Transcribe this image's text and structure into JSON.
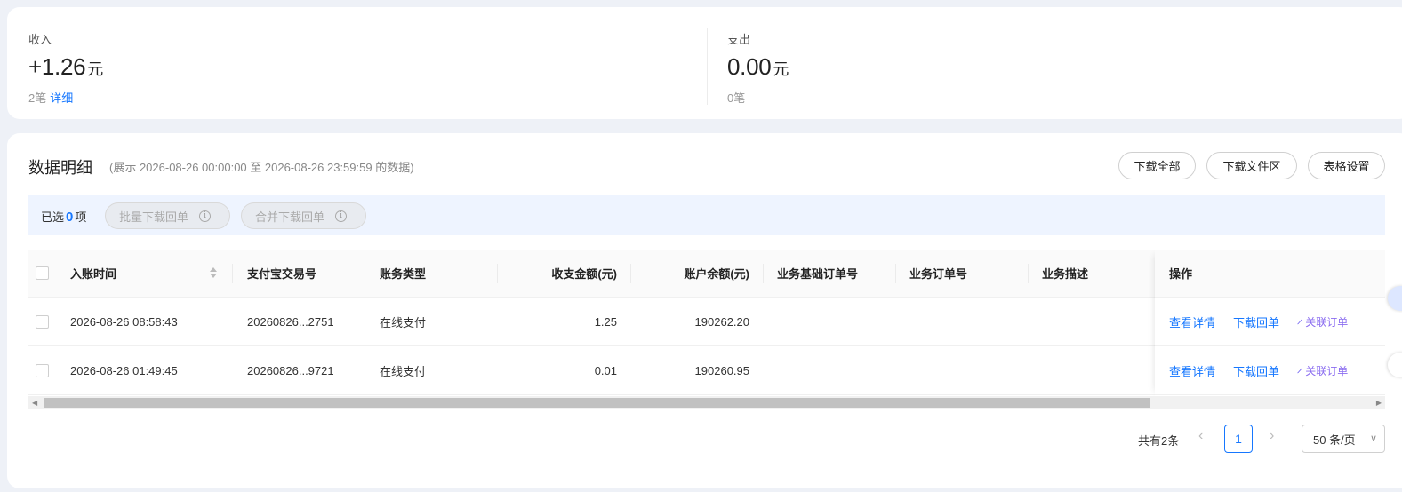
{
  "summary": {
    "income": {
      "label": "收入",
      "value": "+1.26",
      "unit": "元",
      "count": "2笔",
      "detail_link": "详细"
    },
    "expense": {
      "label": "支出",
      "value": "0.00",
      "unit": "元",
      "count": "0笔"
    }
  },
  "details": {
    "title": "数据明细",
    "subtitle": "(展示 2026-08-26 00:00:00 至 2026-08-26 23:59:59 的数据)",
    "buttons": {
      "download_all": "下载全部",
      "download_zone": "下载文件区",
      "table_settings": "表格设置"
    },
    "selection": {
      "prefix": "已选",
      "count": "0",
      "suffix": "项",
      "batch_download": "批量下载回单",
      "merge_download": "合并下载回单",
      "info_glyph": "i"
    },
    "columns": [
      "入账时间",
      "支付宝交易号",
      "账务类型",
      "收支金额(元)",
      "账户余额(元)",
      "业务基础订单号",
      "业务订单号",
      "业务描述",
      "操作"
    ],
    "rows": [
      {
        "time": "2026-08-26 08:58:43",
        "trade_no": "20260826...2751",
        "type": "在线支付",
        "amount": "1.25",
        "balance": "190262.20",
        "actions": [
          "查看详情",
          "下载回单",
          "关联订单"
        ]
      },
      {
        "time": "2026-08-26 01:49:45",
        "trade_no": "20260826...9721",
        "type": "在线支付",
        "amount": "0.01",
        "balance": "190260.95",
        "actions": [
          "查看详情",
          "下载回单",
          "关联订单"
        ]
      }
    ],
    "scroll_arrows": {
      "left": "◀",
      "right": "▶"
    }
  },
  "pagination": {
    "total": "共有2条",
    "prev": "‹",
    "current": "1",
    "next": "›",
    "page_size": "50 条/页",
    "caret": "∨"
  },
  "colors": {
    "accent": "#1677ff",
    "ai_link": "#8a6cf0"
  }
}
